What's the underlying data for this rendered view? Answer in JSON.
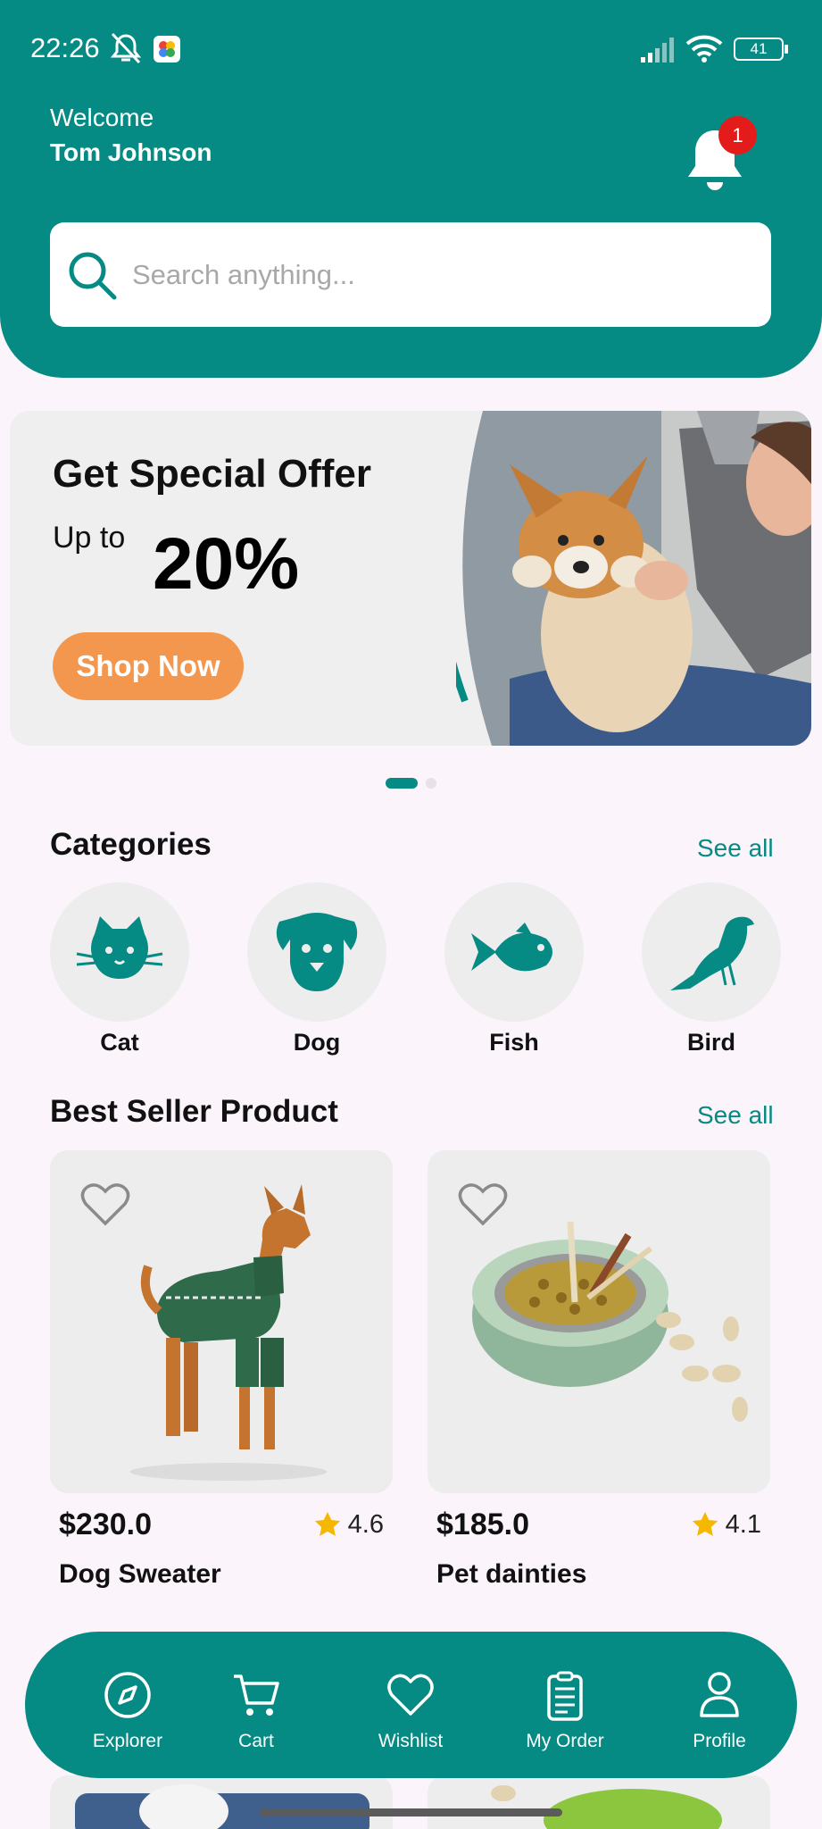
{
  "status_bar": {
    "time": "22:26",
    "battery": "41"
  },
  "header": {
    "welcome": "Welcome",
    "username": "Tom Johnson",
    "notification_count": "1"
  },
  "search": {
    "placeholder": "Search anything..."
  },
  "banner": {
    "title": "Get Special Offer",
    "upto": "Up to",
    "percent": "20%",
    "button": "Shop Now",
    "slide_count": 2,
    "active_slide": 1
  },
  "categories": {
    "title": "Categories",
    "see_all": "See all",
    "items": [
      {
        "label": "Cat",
        "icon": "cat-icon"
      },
      {
        "label": "Dog",
        "icon": "dog-icon"
      },
      {
        "label": "Fish",
        "icon": "fish-icon"
      },
      {
        "label": "Bird",
        "icon": "bird-icon"
      }
    ]
  },
  "best_seller": {
    "title": "Best Seller Product",
    "see_all": "See all",
    "products": [
      {
        "price": "$230.0",
        "rating": "4.6",
        "name": "Dog Sweater"
      },
      {
        "price": "$185.0",
        "rating": "4.1",
        "name": "Pet dainties"
      }
    ]
  },
  "nav": {
    "items": [
      {
        "label": "Explorer",
        "icon": "compass-icon"
      },
      {
        "label": "Cart",
        "icon": "cart-icon"
      },
      {
        "label": "Wishlist",
        "icon": "heart-icon"
      },
      {
        "label": "My Order",
        "icon": "clipboard-icon"
      },
      {
        "label": "Profile",
        "icon": "user-icon"
      }
    ]
  },
  "colors": {
    "primary": "#058a84",
    "accent": "#f3974e",
    "badge": "#e31b1b",
    "star": "#f5b800"
  }
}
